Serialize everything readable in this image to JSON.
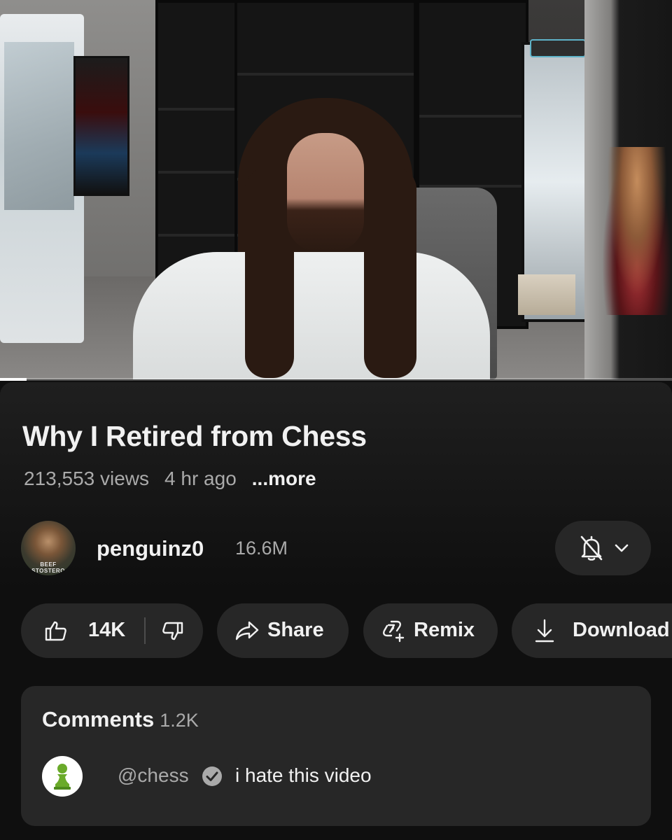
{
  "video": {
    "progress_fraction": 0.04
  },
  "info": {
    "title": "Why I Retired from Chess",
    "views": "213,553 views",
    "age": "4 hr ago",
    "more": "...more"
  },
  "channel": {
    "name": "penguinz0",
    "subscribers": "16.6M",
    "avatar_text_1": "BEEF",
    "avatar_text_2": "STOSTERO",
    "bell_icon": "bell-off-icon",
    "chevron_icon": "chevron-down-icon"
  },
  "actions": {
    "likes": "14K",
    "like_icon": "thumbs-up-icon",
    "dislike_icon": "thumbs-down-icon",
    "share": "Share",
    "share_icon": "share-icon",
    "remix": "Remix",
    "remix_icon": "remix-icon",
    "download": "Download",
    "download_icon": "download-icon"
  },
  "comments": {
    "heading": "Comments",
    "count": "1.2K",
    "top_comment": {
      "handle": "@chess",
      "verified_icon": "verified-check-icon",
      "avatar_icon": "chess-pawn-icon",
      "text": "i hate this video"
    }
  },
  "colors": {
    "background": "#0f0f0f",
    "pill": "#272727",
    "text_primary": "#f1f1f1",
    "text_secondary": "#aaaaaa",
    "pawn_green": "#6aaa2a"
  }
}
